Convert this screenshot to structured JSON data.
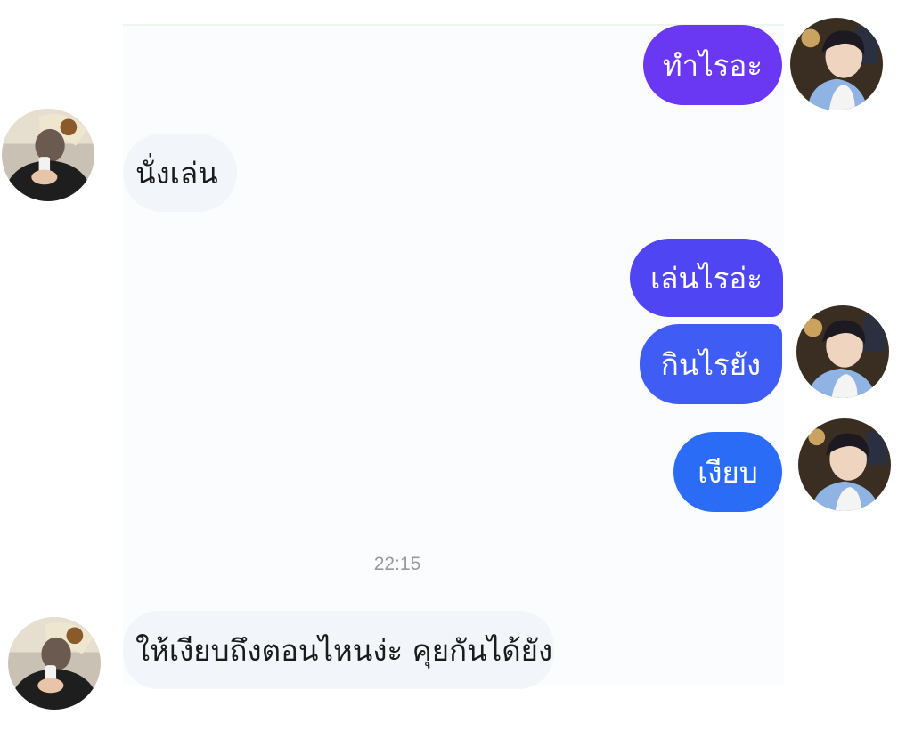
{
  "conversation": {
    "messages": [
      {
        "sender": "self",
        "text": "ทำไรอะ"
      },
      {
        "sender": "other",
        "text": "นั่งเล่น"
      },
      {
        "sender": "self",
        "text": "เล่นไรอ่ะ"
      },
      {
        "sender": "self",
        "text": "กินไรยัง"
      },
      {
        "sender": "self",
        "text": "เงียบ"
      },
      {
        "sender": "other",
        "text": "ให้เงียบถึงตอนไหนง่ะ คุยกันได้ยัง"
      }
    ],
    "timestamp": "22:15"
  },
  "colors": {
    "bubble_gradient_top": "#6a37f2",
    "bubble_gradient_bottom": "#2a6cf5",
    "incoming_bubble": "#f2f5f9",
    "timestamp": "#9a9a9a"
  },
  "icons": {
    "self_avatar": "profile-photo-icon",
    "other_avatar": "profile-photo-icon"
  }
}
